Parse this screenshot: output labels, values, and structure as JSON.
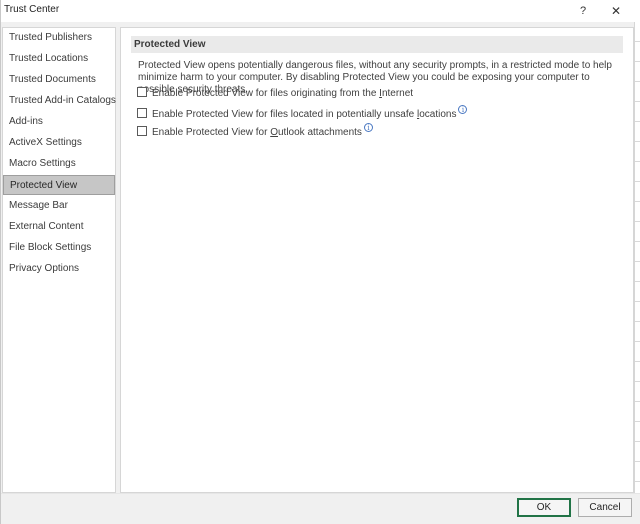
{
  "window": {
    "title": "Trust Center",
    "help_label": "?",
    "close_label": "✕"
  },
  "sidebar": {
    "items": [
      {
        "label": "Trusted Publishers"
      },
      {
        "label": "Trusted Locations"
      },
      {
        "label": "Trusted Documents"
      },
      {
        "label": "Trusted Add-in Catalogs"
      },
      {
        "label": "Add-ins"
      },
      {
        "label": "ActiveX Settings"
      },
      {
        "label": "Macro Settings"
      },
      {
        "label": "Protected View",
        "active": true
      },
      {
        "label": "Message Bar"
      },
      {
        "label": "External Content"
      },
      {
        "label": "File Block Settings"
      },
      {
        "label": "Privacy Options"
      }
    ]
  },
  "content": {
    "header": "Protected View",
    "description": "Protected View opens potentially dangerous files, without any security prompts, in a restricted mode to help minimize harm to your computer. By disabling Protected View you could be exposing your computer to possible security threats.",
    "options": [
      {
        "pre": "Enable Protected View for files originating from the ",
        "key": "I",
        "post": "nternet",
        "checked": false,
        "info": false
      },
      {
        "pre": "Enable Protected View for files located in potentially unsafe ",
        "key": "l",
        "post": "ocations",
        "checked": false,
        "info": true
      },
      {
        "pre": "Enable Protected View for ",
        "key": "O",
        "post": "utlook attachments",
        "checked": false,
        "info": true
      }
    ],
    "info_glyph": "i"
  },
  "footer": {
    "ok_label": "OK",
    "cancel_label": "Cancel"
  }
}
